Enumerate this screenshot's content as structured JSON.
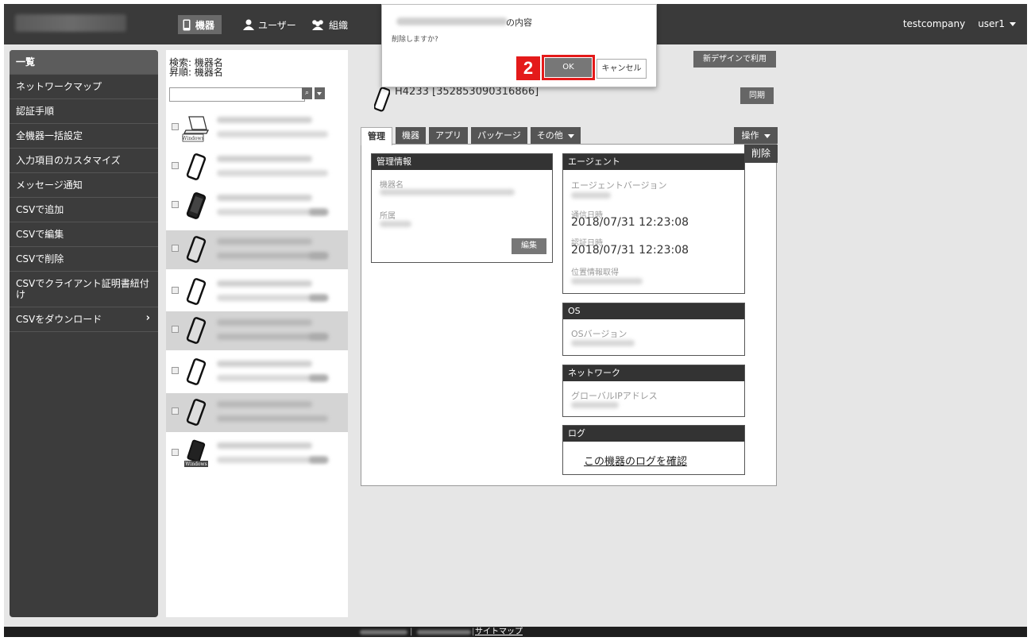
{
  "header": {
    "nav": [
      {
        "label": "機器",
        "icon": "phone-icon"
      },
      {
        "label": "ユーザー",
        "icon": "user-icon"
      },
      {
        "label": "組織",
        "icon": "group-icon"
      }
    ],
    "company": "testcompany",
    "user": "user1"
  },
  "sidebar": {
    "items": [
      {
        "label": "一覧"
      },
      {
        "label": "ネットワークマップ"
      },
      {
        "label": "認証手順"
      },
      {
        "label": "全機器一括設定"
      },
      {
        "label": "入力項目のカスタマイズ"
      },
      {
        "label": "メッセージ通知"
      },
      {
        "label": "CSVで追加"
      },
      {
        "label": "CSVで編集"
      },
      {
        "label": "CSVで削除"
      },
      {
        "label": "CSVでクライアント証明書紐付け"
      },
      {
        "label": "CSVをダウンロード",
        "arrow": "›"
      }
    ]
  },
  "device_list": {
    "search_label": "検索: 機器名",
    "sort_label": "昇順: 機器名",
    "search_value": "",
    "rows": [
      {
        "type": "windows-laptop",
        "icon_label": "Windows",
        "selected": false
      },
      {
        "type": "smartphone",
        "selected": false
      },
      {
        "type": "smartphone",
        "selected": false
      },
      {
        "type": "smartphone",
        "selected": true
      },
      {
        "type": "smartphone",
        "selected": false
      },
      {
        "type": "smartphone",
        "selected": true
      },
      {
        "type": "smartphone",
        "selected": false
      },
      {
        "type": "smartphone",
        "selected": true
      },
      {
        "type": "windows-tablet",
        "icon_label": "Windows",
        "selected": false
      }
    ]
  },
  "main": {
    "new_design_label": "新デザインで利用",
    "device_title": "H4233 [352853090316866]",
    "sync_label": "同期",
    "tabs": [
      "管理",
      "機器",
      "アプリ",
      "パッケージ",
      "その他"
    ],
    "ops_label": "操作",
    "ops_menu_item": "削除",
    "mgmt": {
      "title": "管理情報",
      "name_label": "機器名",
      "affiliation_label": "所属",
      "edit_label": "編集"
    },
    "agent": {
      "title": "エージェント",
      "version_label": "エージェントバージョン",
      "comm_label": "通信日時",
      "comm_value": "2018/07/31 12:23:08",
      "auth_label": "認証日時",
      "auth_value": "2018/07/31 12:23:08",
      "location_label": "位置情報取得"
    },
    "os": {
      "title": "OS",
      "version_label": "OSバージョン"
    },
    "network": {
      "title": "ネットワーク",
      "ip_label": "グローバルIPアドレス"
    },
    "log": {
      "title": "ログ",
      "link_label": "この機器のログを確認"
    }
  },
  "dialog": {
    "title_suffix": "の内容",
    "message": "削除しますか?",
    "ok_label": "OK",
    "cancel_label": "キャンセル",
    "step_number": "2"
  },
  "footer": {
    "sitemap_label": "サイトマップ",
    "separator": "|"
  },
  "colors": {
    "topbar": "#3a3a3a",
    "sidebar": "#3c3c3c",
    "highlight": "#e41a1a"
  }
}
